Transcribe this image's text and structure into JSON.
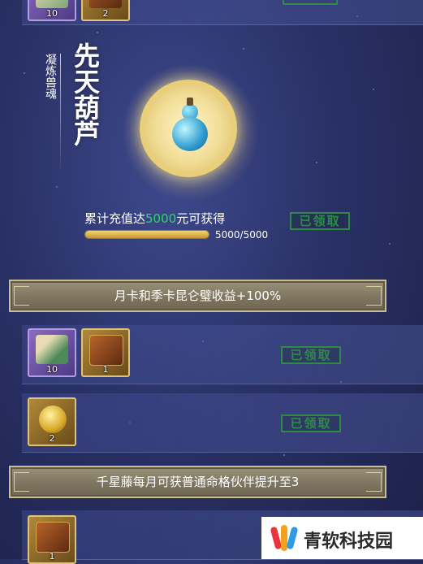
{
  "top_row": {
    "items": [
      {
        "icon": "book-icon",
        "count": "10"
      },
      {
        "icon": "chest-icon",
        "count": "2"
      }
    ]
  },
  "feature": {
    "side_title": "凝炼兽魂",
    "item_name": "先天葫芦",
    "requirement_prefix": "累计充值达",
    "requirement_amount": "5000",
    "requirement_suffix": "元可获得",
    "progress_value": 5000,
    "progress_max": 5000,
    "progress_text": "5000/5000",
    "status_label": "已领取"
  },
  "section1": {
    "banner_text": "月卡和季卡昆仑璧收益+100%",
    "rows": [
      {
        "items": [
          {
            "icon": "book-icon",
            "count": "10",
            "frame": "purple"
          },
          {
            "icon": "chest-icon",
            "count": "1",
            "frame": "gold"
          }
        ],
        "status": "已领取"
      },
      {
        "items": [
          {
            "icon": "gold-coin-icon",
            "count": "2",
            "frame": "gold"
          }
        ],
        "status": "已领取"
      }
    ]
  },
  "section2": {
    "banner_text": "千星藤每月可获普通命格伙伴提升至3",
    "rows": [
      {
        "items": [
          {
            "icon": "chest-icon",
            "count": "1",
            "frame": "gold"
          }
        ]
      }
    ]
  },
  "watermark": {
    "brand": "青软科技园"
  },
  "colors": {
    "accent_green": "#2fd46a",
    "claimed_green": "#2f8a4a",
    "banner_gold": "#c9bd94",
    "progress_gold": "#d8b24a"
  }
}
